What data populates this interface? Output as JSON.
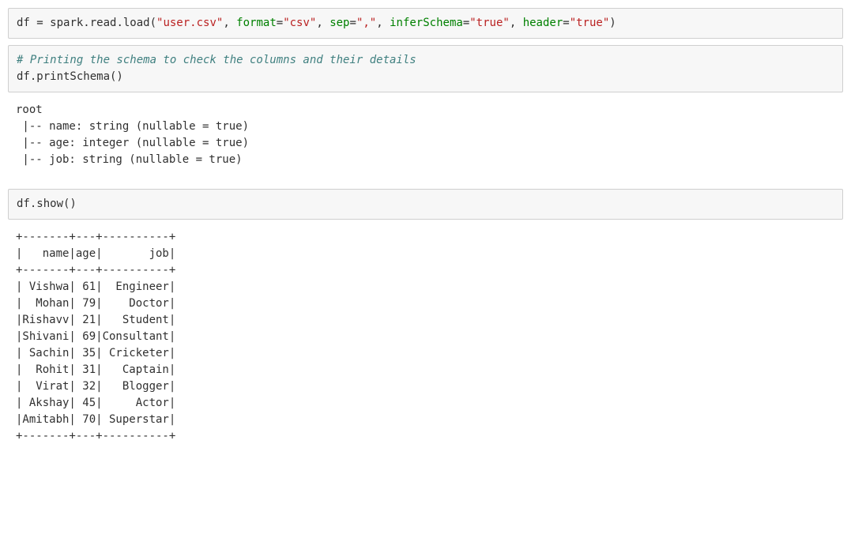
{
  "cell1": {
    "var": "df",
    "eq": " = ",
    "call": "spark.read.load(",
    "arg_file": "\"user.csv\"",
    "sep1": ", ",
    "kw_format": "format",
    "val_format": "\"csv\"",
    "sep2": ", ",
    "kw_sep": "sep",
    "val_sep": "\",\"",
    "sep3": ", ",
    "kw_infer": "inferSchema",
    "val_infer": "\"true\"",
    "sep4": ", ",
    "kw_header": "header",
    "val_header": "\"true\"",
    "close": ")"
  },
  "cell2": {
    "comment": "# Printing the schema to check the columns and their details",
    "stmt": "df.printSchema()"
  },
  "output1": "root\n |-- name: string (nullable = true)\n |-- age: integer (nullable = true)\n |-- job: string (nullable = true)\n",
  "cell3": {
    "stmt": "df.show()"
  },
  "output2": "+-------+---+----------+\n|   name|age|       job|\n+-------+---+----------+\n| Vishwa| 61|  Engineer|\n|  Mohan| 79|    Doctor|\n|Rishavv| 21|   Student|\n|Shivani| 69|Consultant|\n| Sachin| 35| Cricketer|\n|  Rohit| 31|   Captain|\n|  Virat| 32|   Blogger|\n| Akshay| 45|     Actor|\n|Amitabh| 70| Superstar|\n+-------+---+----------+\n"
}
